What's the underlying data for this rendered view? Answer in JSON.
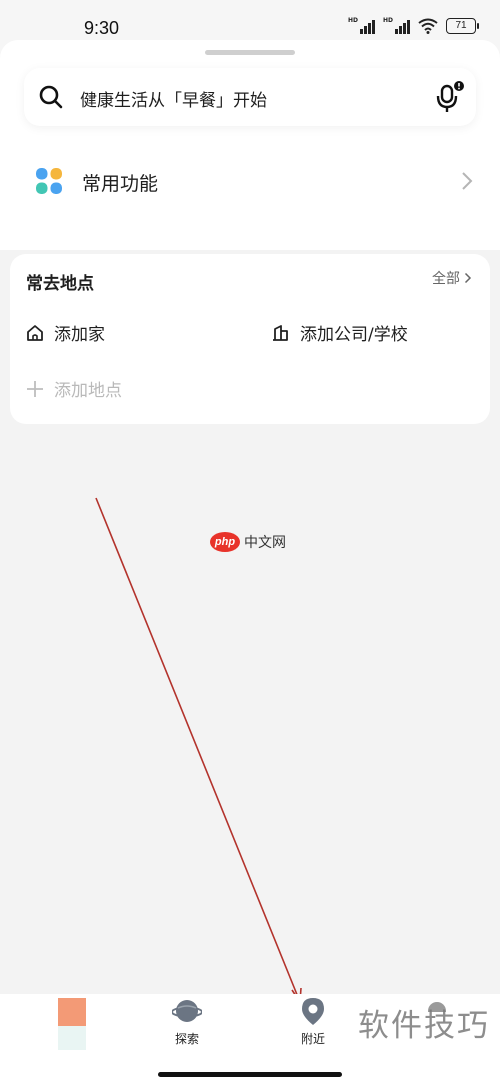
{
  "status_bar": {
    "time": "9:30",
    "battery": "71",
    "hd1": "HD",
    "hd2": "HD"
  },
  "search": {
    "placeholder": "健康生活从「早餐」开始"
  },
  "functions": {
    "label": "常用功能"
  },
  "places": {
    "title": "常去地点",
    "all_label": "全部",
    "home_label": "添加家",
    "work_label": "添加公司/学校",
    "add_label": "添加地点"
  },
  "watermark": {
    "php": "php",
    "site": "中文网",
    "corner": "软件技巧"
  },
  "tab_bar": {
    "tabs": [
      {
        "label": ""
      },
      {
        "label": "探索"
      },
      {
        "label": "附近"
      },
      {
        "label": ""
      }
    ]
  },
  "colors": {
    "accent_red": "#c0392b",
    "home_tab_block": "#f39a76"
  }
}
